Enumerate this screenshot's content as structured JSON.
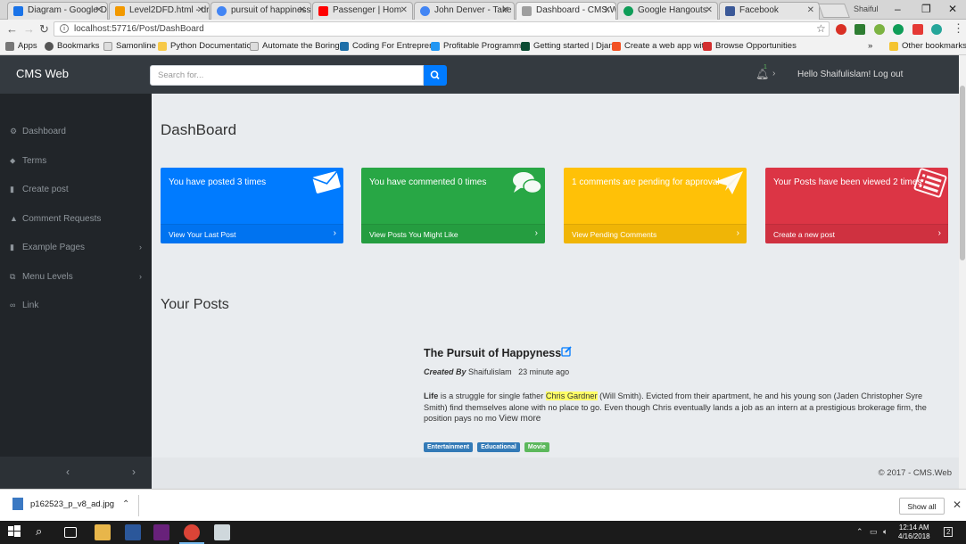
{
  "browser": {
    "tabs": [
      {
        "title": "Diagram - Google D",
        "color": "#1a73e8"
      },
      {
        "title": "Level2DFD.html - dr",
        "color": "#f29900"
      },
      {
        "title": "pursuit of happiness",
        "color": "#4285f4"
      },
      {
        "title": "Passenger | Hom",
        "color": "#ff0000"
      },
      {
        "title": "John Denver - Take",
        "color": "#4285f4"
      },
      {
        "title": "Dashboard - CMS.W",
        "color": "#9e9e9e"
      },
      {
        "title": "Google Hangouts",
        "color": "#0f9d58"
      },
      {
        "title": "Facebook",
        "color": "#3b5998"
      }
    ],
    "user_badge": "Shaiful",
    "url": "localhost:57716/Post/DashBoard",
    "bookmarks": [
      "Apps",
      "Bookmarks",
      "Samonline",
      "Python Documentatio",
      "Automate the Boring",
      "Coding For Entrepren",
      "Profitable Programm",
      "Getting started | Djan",
      "Create a web app wit",
      "Browse Opportunities"
    ],
    "other_bookmarks": "Other bookmarks",
    "chevron": "»"
  },
  "nav": {
    "brand": "CMS Web",
    "search_placeholder": "Search for...",
    "notif_count": "1",
    "hello": "Hello Shaifulislam!",
    "logout": "Log out"
  },
  "sidebar": {
    "items": [
      {
        "label": "Dashboard",
        "icon": "dashboard-icon",
        "glyph": "⚙"
      },
      {
        "label": "Terms",
        "icon": "tag-icon",
        "glyph": "⬥"
      },
      {
        "label": "Create post",
        "icon": "file-icon",
        "glyph": "▮"
      },
      {
        "label": "Comment Requests",
        "icon": "warning-icon",
        "glyph": "▲"
      },
      {
        "label": "Example Pages",
        "icon": "file-icon",
        "glyph": "▮"
      },
      {
        "label": "Menu Levels",
        "icon": "sitemap-icon",
        "glyph": "⧉"
      },
      {
        "label": "Link",
        "icon": "link-icon",
        "glyph": "∞"
      }
    ],
    "toggle_left": "‹",
    "toggle_right": "›"
  },
  "dashboard": {
    "title": "DashBoard",
    "cards": [
      {
        "text": "You have posted 3 times",
        "link": "View Your Last Post",
        "color": "#007bff",
        "icon": "envelope-icon",
        "glyph": "✉"
      },
      {
        "text": "You have commented 0 times",
        "link": "View Posts You Might Like",
        "color": "#28a745",
        "icon": "comments-icon",
        "glyph": "💬"
      },
      {
        "text": "1 comments are pending for approval",
        "link": "View Pending Comments",
        "color": "#ffc107",
        "icon": "paper-plane-icon",
        "glyph": "✈"
      },
      {
        "text": "Your Posts have been viewed 2 times",
        "link": "Create a new post",
        "color": "#dc3545",
        "icon": "list-icon",
        "glyph": "☰"
      }
    ]
  },
  "posts": {
    "heading": "Your Posts",
    "items": [
      {
        "title": "The Pursuit of Happyness",
        "created_by_label": "Created By",
        "author": "Shaifulislam",
        "time": "23 minute ago",
        "body_bold": "Life",
        "body_1": " is a struggle for single father ",
        "highlight": "Chris Gardner",
        "body_2": " (Will Smith). Evicted from their apartment, he and his young son (Jaden Christopher Syre Smith) find themselves alone with no place to go. Even though Chris eventually lands a job as an intern at a prestigious brokerage firm, the position pays no mo ",
        "more": "View more",
        "tags": [
          {
            "label": "Entertainment",
            "color": "#337ab7"
          },
          {
            "label": "Educational",
            "color": "#337ab7"
          },
          {
            "label": "Movie",
            "color": "#5cb85c"
          }
        ]
      }
    ]
  },
  "footer": {
    "text": "© 2017 - CMS.Web"
  },
  "download": {
    "file": "p162523_p_v8_ad.jpg",
    "show_all": "Show all"
  },
  "taskbar": {
    "time": "12:14 AM",
    "date": "4/16/2018",
    "notifications": "2"
  }
}
